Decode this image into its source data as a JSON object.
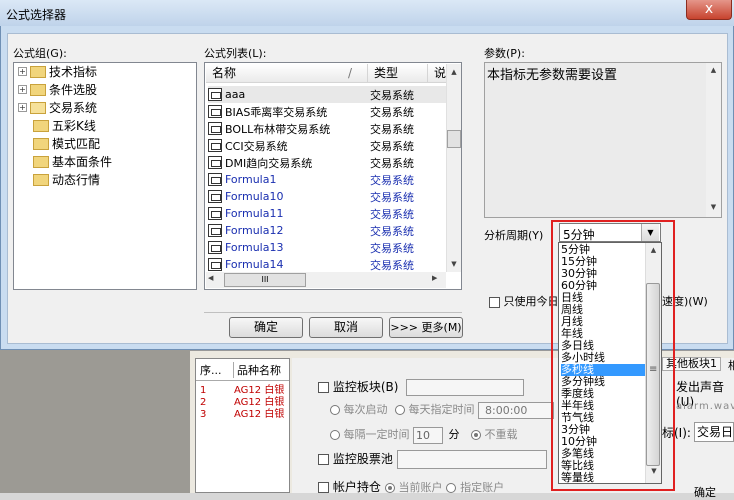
{
  "dialog": {
    "title": "公式选择器",
    "close_glyph": "x",
    "formula_group_label": "公式组(G):",
    "formula_list_label": "公式列表(L):",
    "params_label": "参数(P):",
    "params_text": "本指标无参数需要设置",
    "period_label": "分析周期(Y)",
    "period_value": "5分钟",
    "only_use_label": "只使用今日",
    "speed_text": "速度)(W)",
    "ok_label": "确定",
    "cancel_label": "取消",
    "more_label": ">>> 更多(M)"
  },
  "tree": {
    "expand_glyph": "+",
    "items": [
      "技术指标",
      "条件选股",
      "交易系统",
      "五彩K线",
      "模式匹配",
      "基本面条件",
      "动态行情"
    ]
  },
  "formula_list": {
    "col_name": "名称",
    "col_sep": "/",
    "col_type": "类型",
    "col_desc": "说",
    "rows": [
      {
        "name": "aaa",
        "type": "交易系统"
      },
      {
        "name": "BIAS乖离率交易系统",
        "type": "交易系统"
      },
      {
        "name": "BOLL布林带交易系统",
        "type": "交易系统"
      },
      {
        "name": "CCI交易系统",
        "type": "交易系统"
      },
      {
        "name": "DMI趋向交易系统",
        "type": "交易系统"
      },
      {
        "name": "Formula1",
        "type": "交易系统"
      },
      {
        "name": "Formula10",
        "type": "交易系统"
      },
      {
        "name": "Formula11",
        "type": "交易系统"
      },
      {
        "name": "Formula12",
        "type": "交易系统"
      },
      {
        "name": "Formula13",
        "type": "交易系统"
      },
      {
        "name": "Formula14",
        "type": "交易系统"
      }
    ],
    "hscroll_grip": "III"
  },
  "period_options": [
    "5分钟",
    "15分钟",
    "30分钟",
    "60分钟",
    "日线",
    "周线",
    "月线",
    "年线",
    "多日线",
    "多小时线",
    "多秒线",
    "多分钟线",
    "季度线",
    "半年线",
    "节气线",
    "3分钟",
    "10分钟",
    "多笔线",
    "等比线",
    "等量线"
  ],
  "selected_period_index": 10,
  "scroll_grip": "≡",
  "background": {
    "table_header_seq": "序...",
    "table_header_name": "品种名称",
    "rows": [
      {
        "seq": "1",
        "name": "AG12 白银"
      },
      {
        "seq": "2",
        "name": "AG12 白银"
      },
      {
        "seq": "3",
        "name": "AG12 白银"
      }
    ],
    "monitor_board": "监控板块(B)",
    "every_start": "每次启动",
    "every_day_time": "每天指定时间",
    "time_value": "8:00:00",
    "every_interval": "每隔一定时间",
    "interval_value": "10",
    "minute": "分",
    "no_repeat": "不重载",
    "monitor_pool": "监控股票池",
    "account_position": "帐户持仓",
    "current_account": "当前账户",
    "specified_account": "指定账户",
    "tab_other": "其他板块1",
    "tab_extra": "相",
    "sound_label": "发出声音(U)",
    "sound_file": "alarm.wav",
    "mark_label": "标(I):",
    "mark_value": "交易日",
    "confirm": "确定"
  }
}
